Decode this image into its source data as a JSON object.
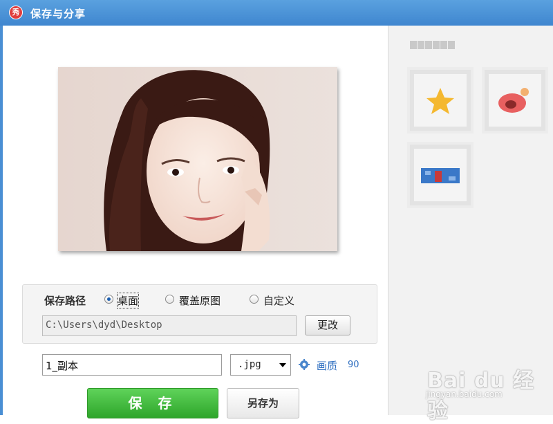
{
  "window": {
    "title": "保存与分享",
    "app_icon_text": "秀"
  },
  "save_path": {
    "label": "保存路径",
    "options": [
      "桌面",
      "覆盖原图",
      "自定义"
    ],
    "selected": "桌面",
    "path_value": "C:\\Users\\dyd\\Desktop",
    "change_button": "更改"
  },
  "file": {
    "name_value": "1_副本",
    "format_value": ".jpg",
    "quality_label": "画质",
    "quality_value": "90"
  },
  "actions": {
    "save_label": "保 存",
    "save_as_label": "另存为"
  },
  "watermark": {
    "main": "Bai du 经验",
    "sub": "jingyan.baidu.com"
  },
  "share_icons": [
    "star-icon",
    "weibo-icon",
    "share-icon"
  ],
  "colors": {
    "titlebar": "#4a92d8",
    "save_green": "#3cb838",
    "link_blue": "#2f6fc1"
  }
}
